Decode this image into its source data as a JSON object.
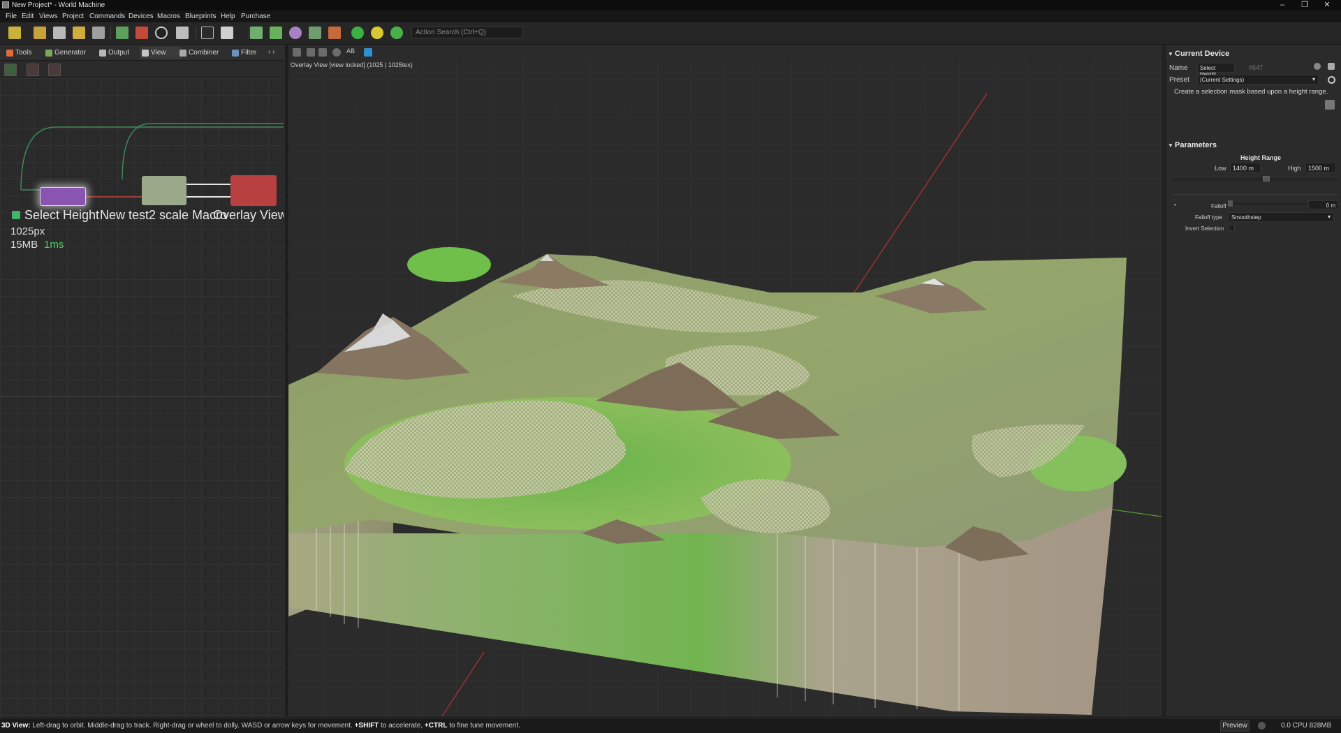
{
  "window": {
    "title": "New Project* - World Machine",
    "controls": [
      "–",
      "❐",
      "✕"
    ]
  },
  "menu": [
    "File",
    "Edit",
    "Views",
    "Project",
    "Commands",
    "Devices",
    "Macros",
    "Blueprints",
    "Help",
    "Purchase"
  ],
  "toolbar": {
    "search_placeholder": "Action Search (Ctrl+Q)"
  },
  "left_panel": {
    "tabs": [
      {
        "label": "Tools",
        "icon": "tools-icon",
        "color": "#e06a3a"
      },
      {
        "label": "Generator",
        "icon": "generator-icon",
        "color": "#7aa85a"
      },
      {
        "label": "Output",
        "icon": "output-icon",
        "color": "#b7b7b7"
      },
      {
        "label": "View",
        "icon": "view-icon",
        "color": "#c6c6c6"
      },
      {
        "label": "Combiner",
        "icon": "combiner-icon",
        "color": "#a9a9a9"
      },
      {
        "label": "Filter",
        "icon": "filter-icon",
        "color": "#6f8fbf"
      }
    ],
    "tab_scroll": "‹ ›",
    "graph": {
      "nodes": [
        {
          "label": "Select Height",
          "color": "#8a55b0"
        },
        {
          "label": "New test2 scale Macro",
          "color": "#9aa98a"
        },
        {
          "label": "Overlay View",
          "color": "#b84040"
        }
      ],
      "info": {
        "resolution": "1025px",
        "memory": "15MB",
        "time": "1ms"
      }
    }
  },
  "viewport": {
    "ab_label": "AB",
    "info": "Overlay View [view locked] (1025 | 1025tex)"
  },
  "right_panel": {
    "current_device": {
      "header": "Current Device",
      "name_label": "Name",
      "name_value": "Select Height",
      "id": "#547",
      "preset_label": "Preset",
      "preset_value": "(Current Settings)",
      "description": "Create a selection mask based upon a height range."
    },
    "parameters": {
      "header": "Parameters",
      "height_range_label": "Height Range",
      "low_label": "Low",
      "low_value": "1400 m",
      "high_label": "High",
      "high_value": "1500 m",
      "falloff_label": "Falloff",
      "falloff_value": "0 m",
      "falloff_type_label": "Falloff type",
      "falloff_type_value": "Smoothstep",
      "invert_label": "Invert Selection"
    }
  },
  "status_bar": {
    "mode": "3D View:",
    "hint_a": "Left-drag to orbit. Middle-drag to track. Right-drag or wheel to dolly. WASD or arrow keys for movement.",
    "key_shift": "+SHIFT",
    "hint_b": "to accelerate,",
    "key_ctrl": "+CTRL",
    "hint_c": "to fine tune movement.",
    "preview_label": "Preview",
    "stats": "0.0 CPU 828MB"
  }
}
